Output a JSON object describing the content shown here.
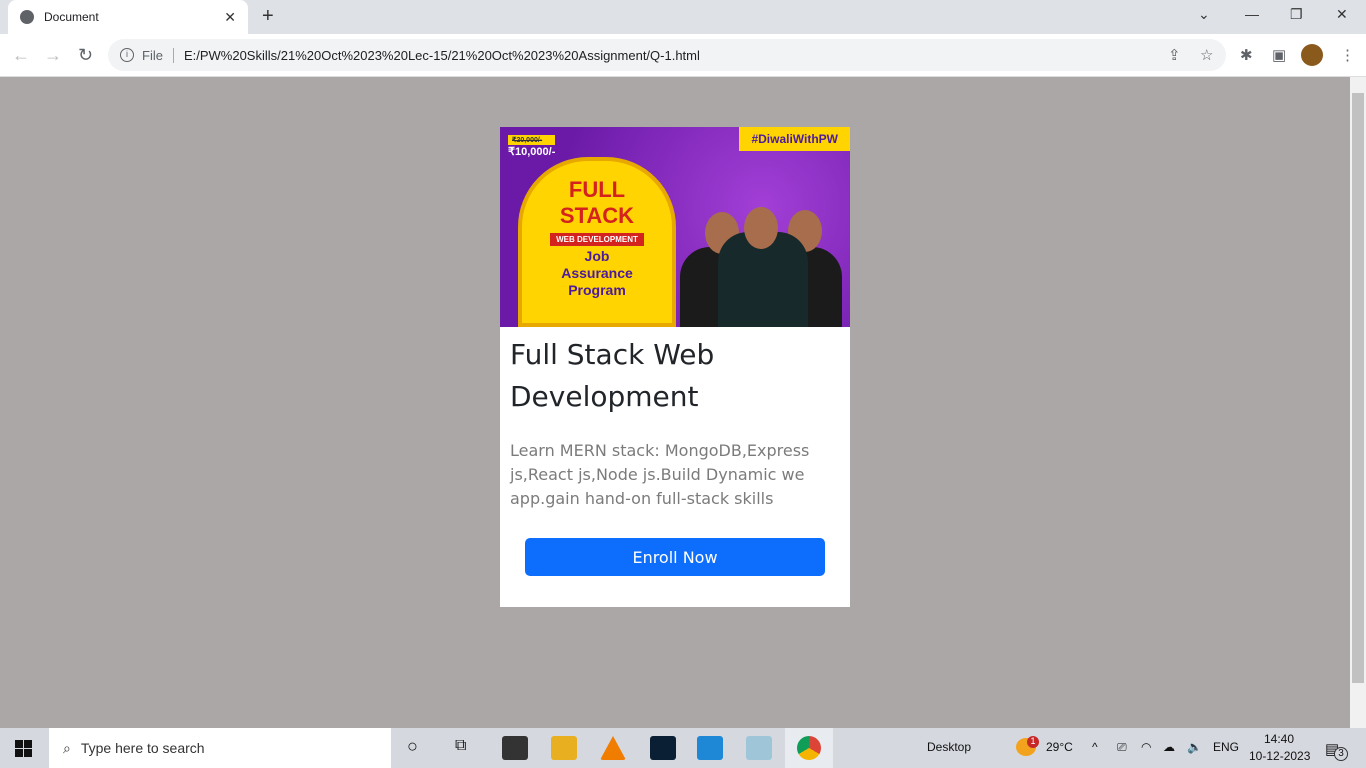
{
  "browser": {
    "tab_title": "Document",
    "url_scheme": "File",
    "url": "E:/PW%20Skills/21%20Oct%2023%20Lec-15/21%20Oct%2023%20Assignment/Q-1.html"
  },
  "card": {
    "banner": {
      "hashtag": "#DiwaliWithPW",
      "old_price": "₹20,000/-",
      "price": "₹10,000/-",
      "headline": "FULL STACK",
      "tag": "WEB DEVELOPMENT",
      "subline": "Job Assurance Program"
    },
    "title": "Full Stack Web Development",
    "description": "Learn MERN stack: MongoDB,Express js,React js,Node js.Build Dynamic we app.gain hand-on full-stack skills",
    "button": "Enroll Now",
    "button_color": "#0d6efd"
  },
  "taskbar": {
    "search_placeholder": "Type here to search",
    "desktop_label": "Desktop",
    "weather": "29°C",
    "weather_badge": "1",
    "language": "ENG",
    "time": "14:40",
    "date": "10-12-2023",
    "notifications": "3"
  }
}
